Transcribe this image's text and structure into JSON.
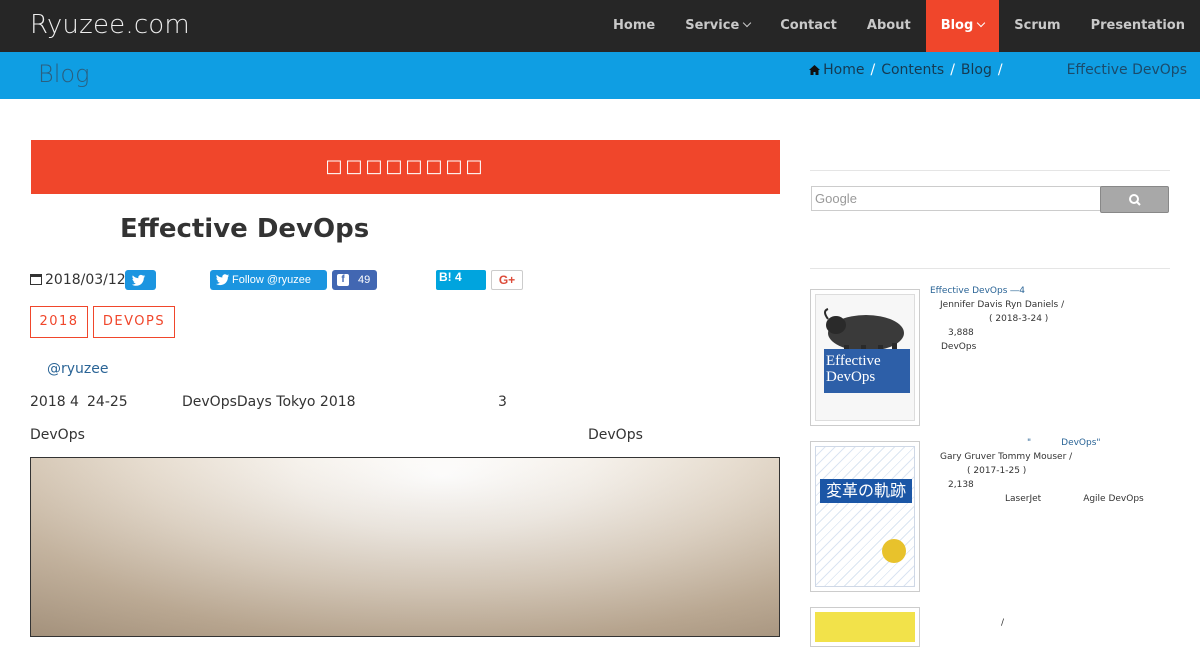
{
  "header": {
    "brand": "Ryuzee.com",
    "nav": [
      {
        "label": "Home",
        "dropdown": false,
        "active": false
      },
      {
        "label": "Service",
        "dropdown": true,
        "active": false
      },
      {
        "label": "Contact",
        "dropdown": false,
        "active": false
      },
      {
        "label": "About",
        "dropdown": false,
        "active": false
      },
      {
        "label": "Blog",
        "dropdown": true,
        "active": true
      },
      {
        "label": "Scrum",
        "dropdown": false,
        "active": false
      },
      {
        "label": "Presentation",
        "dropdown": false,
        "active": false
      }
    ]
  },
  "subheader": {
    "title": "Blog",
    "breadcrumb": {
      "home": "Home",
      "contents": "Contents",
      "blog": "Blog",
      "sep": "/",
      "current": "Effective DevOps"
    }
  },
  "post": {
    "banner": "□□□□□□□□",
    "title": "Effective DevOps",
    "date": "2018/03/12",
    "follow": "Follow @ryuzee",
    "fb_count": "49",
    "hatena": "B! 4",
    "gplus": "G+",
    "tags": [
      "2018",
      "DEVOPS"
    ],
    "author": "@ryuzee",
    "line1": {
      "a": "2018",
      "b": "4",
      "c": "24-25",
      "d": "DevOpsDays Tokyo 2018",
      "e": "3"
    },
    "line2": {
      "a": "DevOps",
      "b": "DevOps"
    }
  },
  "sidebar": {
    "search_placeholder": "Google",
    "books": [
      {
        "title": "Effective DevOps ―4",
        "authors": "Jennifer Davis   Ryn Daniels /",
        "date": "( 2018-3-24 )",
        "price": "3,888",
        "note": "DevOps",
        "cover_title": "Effective DevOps"
      },
      {
        "title_a": "\"",
        "title_b": "DevOps\"",
        "authors": "Gary Gruver   Tommy Mouser /",
        "date": "( 2017-1-25 )",
        "price": "2,138",
        "note_a": "LaserJet",
        "note_b": "Agile   DevOps",
        "cover_title": "変革の軌跡"
      },
      {
        "authors": "/"
      }
    ]
  },
  "colors": {
    "accent": "#f0462b",
    "topbar": "#262626",
    "subbar": "#0f9ee3",
    "link": "#2a6496"
  }
}
